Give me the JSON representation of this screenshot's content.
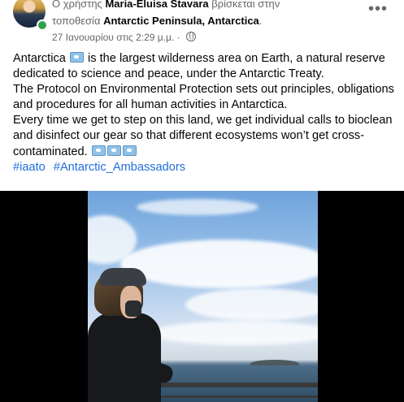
{
  "header": {
    "prefix": "Ο χρήστης",
    "user_name": "Maria-Eluisa Stavara",
    "location_phrase": "βρίσκεται στην",
    "location_prefix": "τοποθεσία",
    "location_name": "Antarctic Peninsula, Antarctica",
    "location_suffix": ".",
    "timestamp": "27 Ιανουαρίου στις 2:29 μ.μ. ·",
    "privacy_icon": "globe-icon",
    "more_icon": "more-horizontal-icon",
    "more_label": "•••"
  },
  "post": {
    "para1_a": "Antarctica",
    "para1_b": " is the largest wilderness  area on Earth, a natural reserve dedicated to science and peace, under the Antarctic Treaty.",
    "para2": "The Protocol on Environmental Protection sets out principles, obligations and procedures for all human activities in Antarctica.",
    "para3": "Every time we get to step on this land, we get individual calls to bioclean and disinfect our gear so that different ecosystems won’t get cross-contaminated.",
    "flag_icon": "antarctica-flag-emoji",
    "hashtags": [
      "#iaato",
      "#Antarctic_Ambassadors"
    ]
  },
  "colors": {
    "link": "#216fdb",
    "secondary_text": "#65676b",
    "online_status": "#31a24c"
  }
}
